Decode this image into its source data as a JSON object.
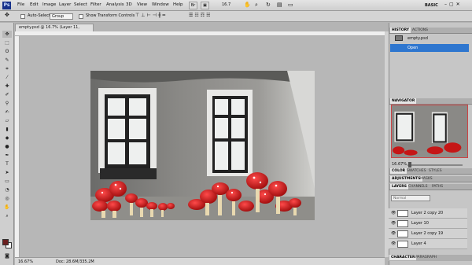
{
  "menubar": {
    "logo": "Ps",
    "items": [
      "File",
      "Edit",
      "Image",
      "Layer",
      "Select",
      "Filter",
      "Analysis",
      "3D",
      "View",
      "Window",
      "Help"
    ],
    "zoom": "16.7",
    "workspace": "BASIC"
  },
  "options": {
    "auto_select_label": "Auto-Select:",
    "auto_select_value": "Group",
    "show_transform_label": "Show Transform Controls"
  },
  "document": {
    "tab_title": "empty.psd @ 16.7% (Layer 11, RGB/8) *",
    "status_zoom": "16.67%",
    "status_doc": "Doc: 28.6M/335.2M"
  },
  "history": {
    "tabs": [
      "HISTORY",
      "ACTIONS"
    ],
    "snapshot_name": "empty.psd",
    "open_state": "Open"
  },
  "navigator": {
    "tab": "NAVIGATOR",
    "zoom": "16.67%"
  },
  "color_panel": {
    "tabs": [
      "COLOR",
      "SWATCHES",
      "STYLES"
    ]
  },
  "adjustments_panel": {
    "tabs": [
      "ADJUSTMENTS",
      "MASKS"
    ]
  },
  "layers_panel": {
    "tabs": [
      "LAYERS",
      "CHANNELS",
      "PATHS"
    ],
    "blend_mode": "Normal",
    "layers": [
      "Layer 2 copy 20",
      "Layer 10",
      "Layer 2 copy 19",
      "Layer 4"
    ]
  },
  "bottom_panels": {
    "tabs": [
      "CHARACTER",
      "PARAGRAPH"
    ]
  },
  "colors": {
    "accent_selected": "#2e76cf",
    "foreground_swatch": "#6a1f1f",
    "background_swatch": "#ffffff"
  }
}
